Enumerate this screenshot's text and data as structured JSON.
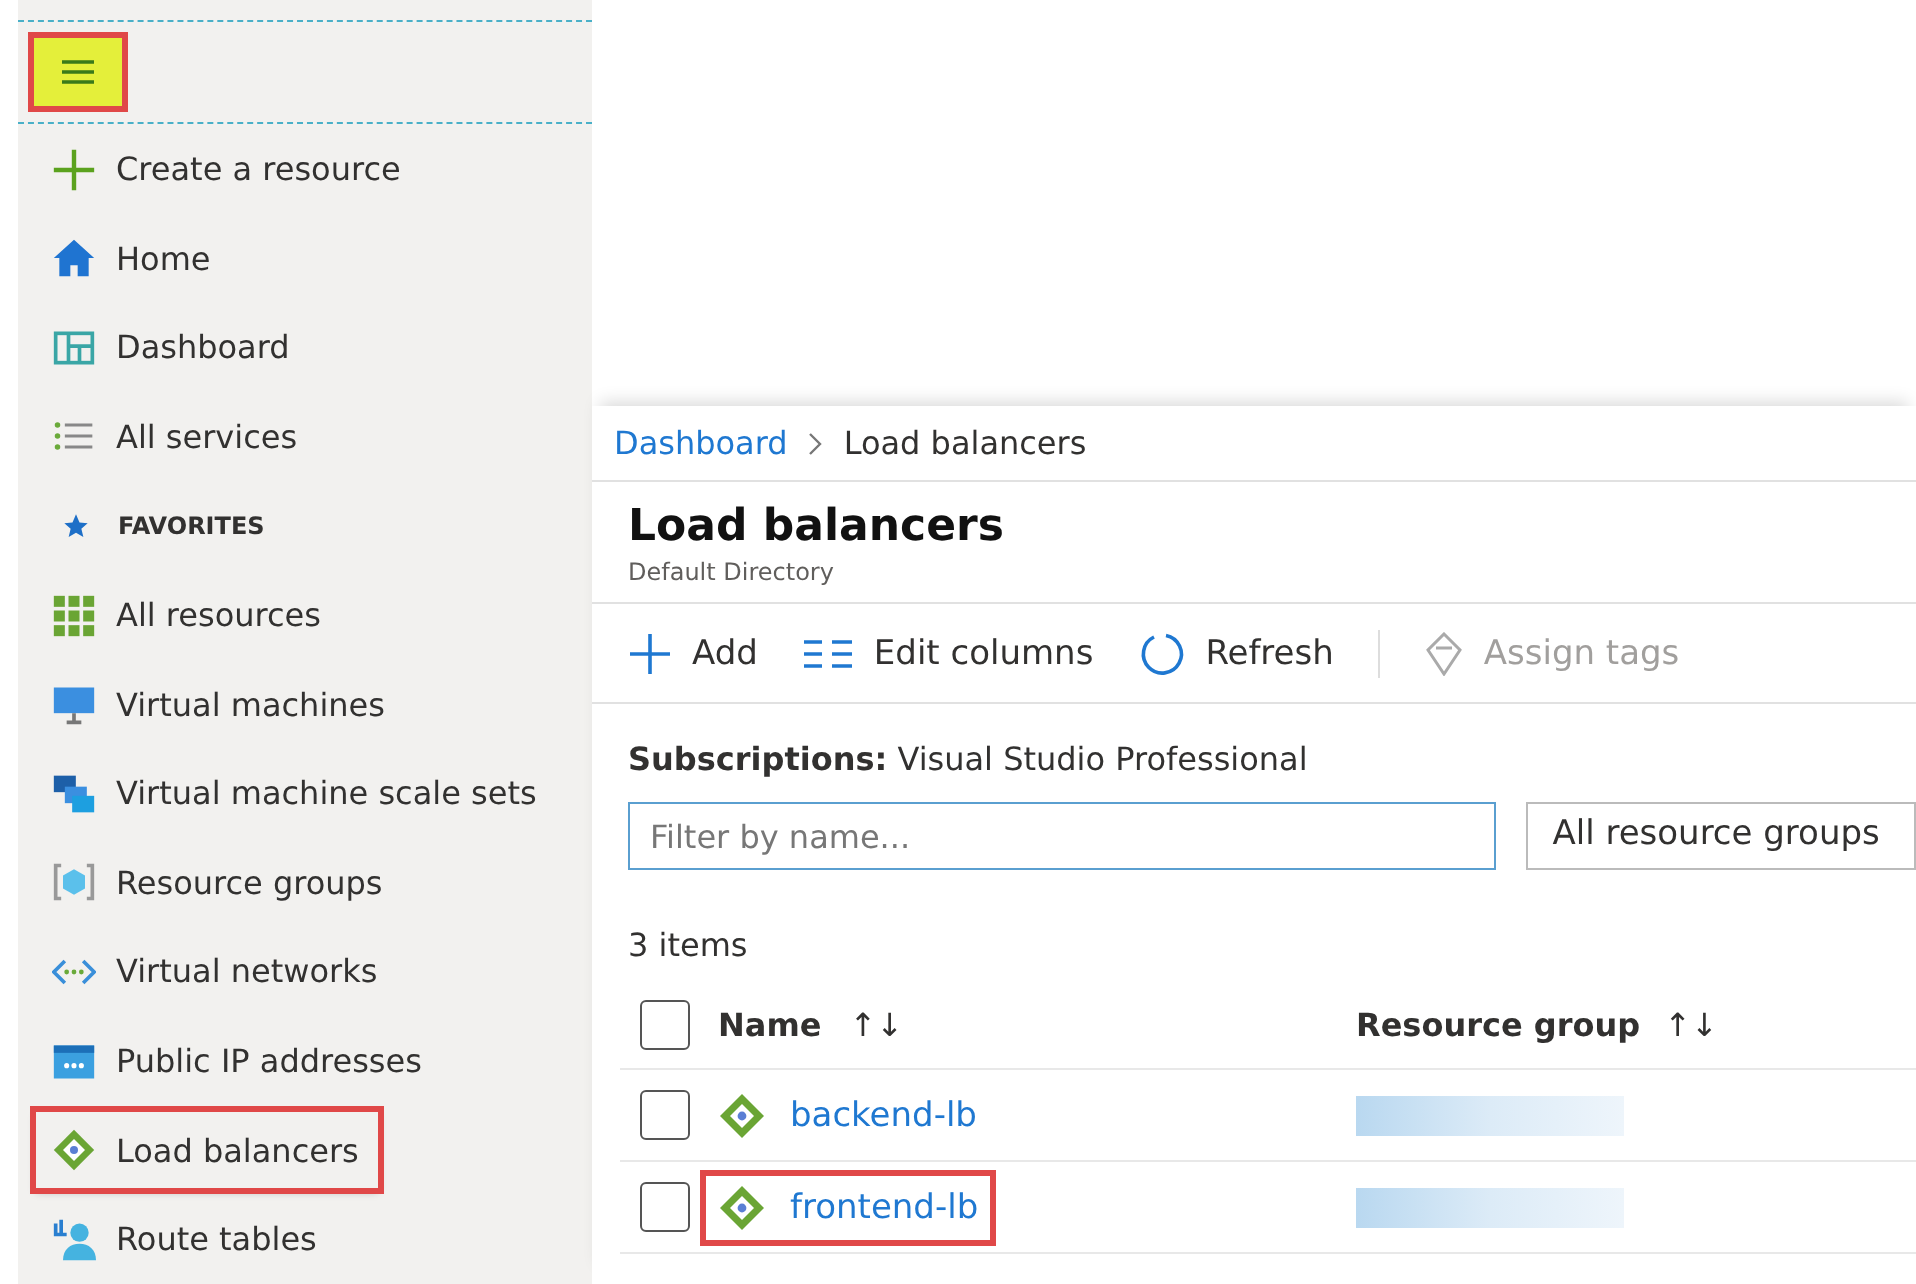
{
  "menu_button": {
    "highlighted": true
  },
  "sidebar": {
    "items": [
      {
        "kind": "link",
        "label": "Create a resource",
        "highlighted": false
      },
      {
        "kind": "link",
        "label": "Home",
        "highlighted": false
      },
      {
        "kind": "link",
        "label": "Dashboard",
        "highlighted": false
      },
      {
        "kind": "link",
        "label": "All services",
        "highlighted": false
      },
      {
        "kind": "header",
        "label": "FAVORITES"
      },
      {
        "kind": "link",
        "label": "All resources",
        "highlighted": false
      },
      {
        "kind": "link",
        "label": "Virtual machines",
        "highlighted": false
      },
      {
        "kind": "link",
        "label": "Virtual machine scale sets",
        "highlighted": false
      },
      {
        "kind": "link",
        "label": "Resource groups",
        "highlighted": false
      },
      {
        "kind": "link",
        "label": "Virtual networks",
        "highlighted": false
      },
      {
        "kind": "link",
        "label": "Public IP addresses",
        "highlighted": false
      },
      {
        "kind": "link",
        "label": "Load balancers",
        "highlighted": true
      },
      {
        "kind": "link",
        "label": "Route tables",
        "highlighted": false
      }
    ]
  },
  "breadcrumb": [
    {
      "label": "Dashboard",
      "link": true
    },
    {
      "label": "Load balancers",
      "link": false
    }
  ],
  "page": {
    "title": "Load balancers",
    "subtitle": "Default Directory"
  },
  "toolbar": [
    {
      "label": "Add",
      "disabled": false
    },
    {
      "label": "Edit columns",
      "disabled": false
    },
    {
      "label": "Refresh",
      "disabled": false
    },
    {
      "label": "Assign tags",
      "disabled": true
    }
  ],
  "subscriptions": {
    "label": "Subscriptions:",
    "value": "Visual Studio Professional"
  },
  "filter": {
    "placeholder": "Filter by name..."
  },
  "group_filter": {
    "value": "All resource groups"
  },
  "item_count": "3 items",
  "table": {
    "select_all": {
      "checked": false
    },
    "columns": [
      {
        "label": "Name",
        "sort": "↑↓"
      },
      {
        "label": "Resource group",
        "sort": "↑↓"
      }
    ],
    "rows": [
      {
        "name": "backend-lb",
        "checked": false,
        "highlighted": false
      },
      {
        "name": "frontend-lb",
        "checked": false,
        "highlighted": true
      }
    ]
  }
}
